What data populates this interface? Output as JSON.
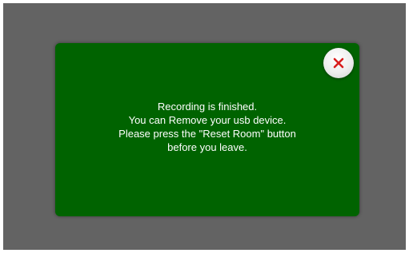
{
  "colors": {
    "backdrop": "#636363",
    "dialog_background": "#006300",
    "message_text": "#ffffff",
    "close_icon": "#d81b1b"
  },
  "dialog": {
    "close_icon": "close-icon",
    "message_lines": [
      "Recording is finished.",
      "You can Remove your usb device.",
      "Please press the \"Reset Room\" button",
      "before you leave."
    ]
  }
}
